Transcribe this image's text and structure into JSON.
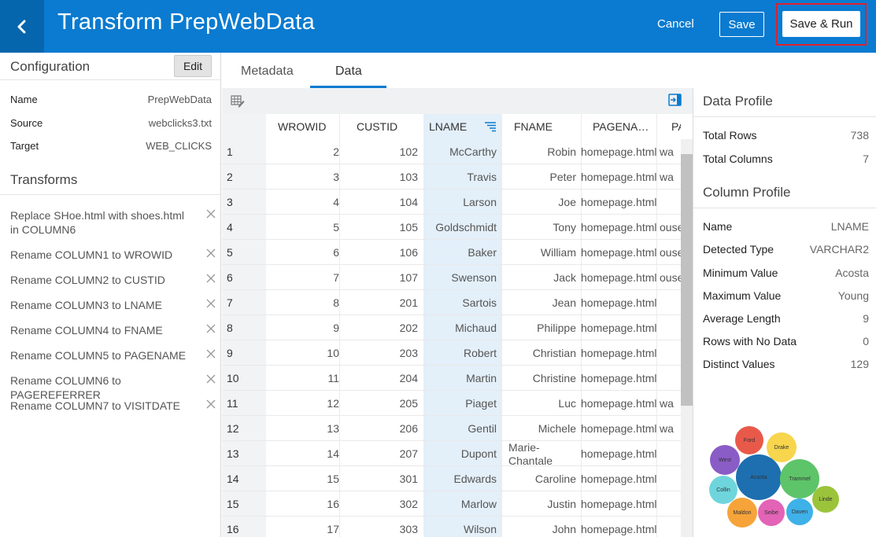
{
  "header": {
    "title": "Transform PrepWebData",
    "cancel_label": "Cancel",
    "save_label": "Save",
    "save_run_label": "Save & Run"
  },
  "configuration": {
    "title": "Configuration",
    "edit_label": "Edit",
    "rows": [
      {
        "key": "Name",
        "value": "PrepWebData"
      },
      {
        "key": "Source",
        "value": "webclicks3.txt"
      },
      {
        "key": "Target",
        "value": "WEB_CLICKS"
      }
    ]
  },
  "transforms": {
    "title": "Transforms",
    "items": [
      "Replace SHoe.html with shoes.html in COLUMN6",
      "Rename COLUMN1 to WROWID",
      "Rename COLUMN2 to CUSTID",
      "Rename COLUMN3 to LNAME",
      "Rename COLUMN4 to FNAME",
      "Rename COLUMN5 to PAGENAME",
      "Rename COLUMN6 to PAGEREFERRER",
      "Rename COLUMN7 to VISITDATE"
    ]
  },
  "tabs": {
    "metadata": "Metadata",
    "data": "Data"
  },
  "grid": {
    "columns": [
      "WROWID",
      "CUSTID",
      "LNAME",
      "FNAME",
      "PAGENA…",
      "PA"
    ],
    "rows": [
      [
        "1",
        "2",
        "102",
        "McCarthy",
        "Robin",
        "homepage.html",
        "wa"
      ],
      [
        "2",
        "3",
        "103",
        "Travis",
        "Peter",
        "homepage.html",
        "wa"
      ],
      [
        "3",
        "4",
        "104",
        "Larson",
        "Joe",
        "homepage.html",
        ""
      ],
      [
        "4",
        "5",
        "105",
        "Goldschmidt",
        "Tony",
        "homepage.html",
        "ouse"
      ],
      [
        "5",
        "6",
        "106",
        "Baker",
        "William",
        "homepage.html",
        "ouse"
      ],
      [
        "6",
        "7",
        "107",
        "Swenson",
        "Jack",
        "homepage.html",
        "ouse"
      ],
      [
        "7",
        "8",
        "201",
        "Sartois",
        "Jean",
        "homepage.html",
        ""
      ],
      [
        "8",
        "9",
        "202",
        "Michaud",
        "Philippe",
        "homepage.html",
        ""
      ],
      [
        "9",
        "10",
        "203",
        "Robert",
        "Christian",
        "homepage.html",
        ""
      ],
      [
        "10",
        "11",
        "204",
        "Martin",
        "Christine",
        "homepage.html",
        ""
      ],
      [
        "11",
        "12",
        "205",
        "Piaget",
        "Luc",
        "homepage.html",
        "wa"
      ],
      [
        "12",
        "13",
        "206",
        "Gentil",
        "Michele",
        "homepage.html",
        "wa"
      ],
      [
        "13",
        "14",
        "207",
        "Dupont",
        "Marie-Chantale",
        "homepage.html",
        ""
      ],
      [
        "14",
        "15",
        "301",
        "Edwards",
        "Caroline",
        "homepage.html",
        ""
      ],
      [
        "15",
        "16",
        "302",
        "Marlow",
        "Justin",
        "homepage.html",
        ""
      ],
      [
        "16",
        "17",
        "303",
        "Wilson",
        "John",
        "homepage.html",
        ""
      ]
    ]
  },
  "data_profile": {
    "title": "Data Profile",
    "rows": [
      {
        "key": "Total Rows",
        "value": "738"
      },
      {
        "key": "Total Columns",
        "value": "7"
      }
    ]
  },
  "column_profile": {
    "title": "Column Profile",
    "rows": [
      {
        "key": "Name",
        "value": "LNAME"
      },
      {
        "key": "Detected Type",
        "value": "VARCHAR2"
      },
      {
        "key": "Minimum Value",
        "value": "Acosta"
      },
      {
        "key": "Maximum Value",
        "value": "Young"
      },
      {
        "key": "Average Length",
        "value": "9"
      },
      {
        "key": "Rows with No Data",
        "value": "0"
      },
      {
        "key": "Distinct Values",
        "value": "129"
      }
    ]
  },
  "bubbles": [
    {
      "label": "Ford",
      "color": "#e9594a"
    },
    {
      "label": "Drake",
      "color": "#f7d54c"
    },
    {
      "label": "West",
      "color": "#8a5cc6"
    },
    {
      "label": "Acosta",
      "color": "#1d6faf"
    },
    {
      "label": "Trammel",
      "color": "#5ec46a"
    },
    {
      "label": "Linde",
      "color": "#9bc43b"
    },
    {
      "label": "Collin",
      "color": "#6fd5dd"
    },
    {
      "label": "Maldon",
      "color": "#f6a43a"
    },
    {
      "label": "Seibe",
      "color": "#e363b6"
    },
    {
      "label": "Daven",
      "color": "#3eb1e8"
    }
  ],
  "colors": {
    "header_bg": "#0a7bd0",
    "back_bg": "#0566ad",
    "highlight_outline": "#e0202c",
    "selected_column": "#e3eff9"
  }
}
